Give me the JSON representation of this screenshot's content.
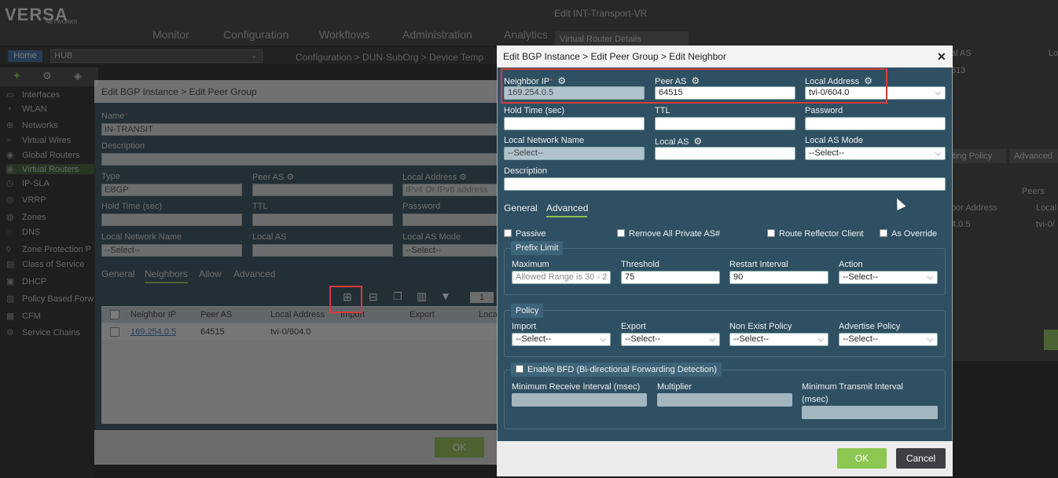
{
  "app": {
    "logo": "VERSA",
    "logo_sub": "NETWORKS",
    "nav": [
      "Monitor",
      "Configuration",
      "Workflows",
      "Administration",
      "Analytics"
    ],
    "home": "Home",
    "org": "HUB",
    "breadcrumb": "Configuration  >  DUN-SubOrg  >  Device Temp",
    "sidebar": [
      "Interfaces",
      "WLAN",
      "Networks",
      "Virtual Wires",
      "Global Routers",
      "Virtual Routers",
      "IP-SLA",
      "VRRP",
      "Zones",
      "DNS",
      "Zone Protection P",
      "Class of Service",
      "DHCP",
      "Policy Based Forw",
      "CFM",
      "Service Chains"
    ],
    "right_panel": {
      "title": "Edit INT-Transport-VR",
      "tab": "Virtual Router Details",
      "col_local_as": "al AS",
      "col_lo": "Lo",
      "val_613": "613",
      "tab_routing_policy": "ting Policy",
      "tab_advanced": "Advanced",
      "col_peers": "Peers",
      "col_neighbor_address": "bor Address",
      "col_local": "Local",
      "row_addr": "4.0.5",
      "row_local": "tvi-0/"
    }
  },
  "peer_group_dialog": {
    "title": "Edit BGP Instance > Edit Peer Group",
    "name_label": "Name",
    "name_value": "IN-TRANSIT",
    "description_label": "Description",
    "type_label": "Type",
    "type_value": "EBGP",
    "peer_as_label": "Peer AS",
    "local_address_label": "Local Address",
    "local_address_placeholder": "IPv4 Or IPv6 address",
    "hold_time_label": "Hold Time (sec)",
    "ttl_label": "TTL",
    "password_label": "Password",
    "local_network_name_label": "Local Network Name",
    "local_network_name_value": "--Select--",
    "local_as_label": "Local AS",
    "local_as_mode_label": "Local AS Mode",
    "local_as_mode_value": "--Select--",
    "tabs": [
      "General",
      "Neighbors",
      "Allow",
      "Advanced"
    ],
    "page_number": "1",
    "columns": [
      "Neighbor IP",
      "Peer AS",
      "Local Address",
      "Import",
      "Export",
      "Loca"
    ],
    "rows": [
      {
        "neighbor_ip": "169.254.0.5",
        "peer_as": "64515",
        "local_address": "tvi-0/604.0"
      }
    ],
    "ok": "OK"
  },
  "neighbor_dialog": {
    "title": "Edit BGP Instance > Edit Peer Group > Edit Neighbor",
    "neighbor_ip_label": "Neighbor IP",
    "neighbor_ip_value": "169.254.0.5",
    "peer_as_label": "Peer AS",
    "peer_as_value": "64515",
    "local_address_label": "Local Address",
    "local_address_value": "tvi-0/604.0",
    "hold_time_label": "Hold Time (sec)",
    "ttl_label": "TTL",
    "password_label": "Password",
    "local_network_name_label": "Local Network Name",
    "local_network_name_value": "--Select--",
    "local_as_label": "Local AS",
    "local_as_mode_label": "Local AS Mode",
    "local_as_mode_value": "--Select--",
    "description_label": "Description",
    "tabs": [
      "General",
      "Advanced"
    ],
    "active_tab": "Advanced",
    "checkboxes": {
      "passive": "Passive",
      "remove_private_as": "Remove All Private AS#",
      "route_reflector_client": "Route Reflector Client",
      "as_override": "As Override"
    },
    "prefix_limit": {
      "legend": "Prefix Limit",
      "maximum_label": "Maximum",
      "maximum_placeholder": "Allowed Range is 30 - 2",
      "threshold_label": "Threshold",
      "threshold_value": "75",
      "restart_interval_label": "Restart Interval",
      "restart_interval_value": "90",
      "action_label": "Action",
      "action_value": "--Select--"
    },
    "policy": {
      "legend": "Policy",
      "import_label": "Import",
      "import_value": "--Select--",
      "export_label": "Export",
      "export_value": "--Select--",
      "non_exist_label": "Non Exist Policy",
      "non_exist_value": "--Select--",
      "advertise_label": "Advertise Policy",
      "advertise_value": "--Select--"
    },
    "bfd": {
      "legend": "Enable BFD (Bi-directional Forwarding Detection)",
      "min_receive_label": "Minimum Receive Interval (msec)",
      "multiplier_label": "Multiplier",
      "min_transmit_label": "Minimum Transmit Interval",
      "min_transmit_label2": "(msec)"
    },
    "ok": "OK",
    "cancel": "Cancel"
  }
}
